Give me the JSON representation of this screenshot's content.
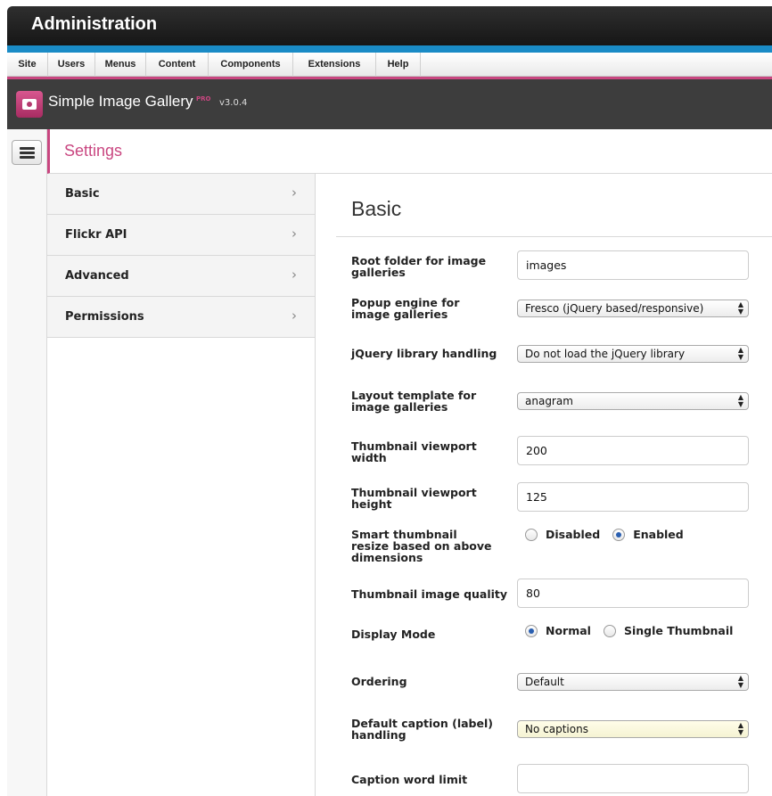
{
  "header": {
    "title": "Administration"
  },
  "menu": [
    "Site",
    "Users",
    "Menus",
    "Content",
    "Components",
    "Extensions",
    "Help"
  ],
  "component": {
    "name": "Simple Image Gallery",
    "badge": "PRO",
    "version": "v3.0.4"
  },
  "settings": {
    "title": "Settings"
  },
  "tabs": [
    {
      "label": "Basic"
    },
    {
      "label": "Flickr API"
    },
    {
      "label": "Advanced"
    },
    {
      "label": "Permissions"
    }
  ],
  "panel": {
    "title": "Basic"
  },
  "form": {
    "root_folder": {
      "label": "Root folder for image galleries",
      "value": "images"
    },
    "popup_engine": {
      "label": "Popup engine for image galleries",
      "value": "Fresco (jQuery based/responsive)"
    },
    "jquery": {
      "label": "jQuery library handling",
      "value": "Do not load the jQuery library"
    },
    "layout": {
      "label": "Layout template for image galleries",
      "value": "anagram"
    },
    "thumb_width": {
      "label": "Thumbnail viewport width",
      "value": "200"
    },
    "thumb_height": {
      "label": "Thumbnail viewport height",
      "value": "125"
    },
    "smart_resize": {
      "label": "Smart thumbnail resize based on above dimensions",
      "options": [
        "Disabled",
        "Enabled"
      ],
      "selected": "Enabled"
    },
    "quality": {
      "label": "Thumbnail image quality",
      "value": "80"
    },
    "display_mode": {
      "label": "Display Mode",
      "options": [
        "Normal",
        "Single Thumbnail"
      ],
      "selected": "Normal"
    },
    "ordering": {
      "label": "Ordering",
      "value": "Default"
    },
    "caption_handling": {
      "label": "Default caption (label) handling",
      "value": "No captions"
    },
    "caption_limit": {
      "label": "Caption word limit",
      "value": ""
    }
  },
  "icons": {
    "chevron": "chevron-right-icon",
    "menu": "hamburger-icon",
    "logo": "camera-icon"
  },
  "colors": {
    "accent": "#c94680",
    "blue_bar": "#1a8bc6",
    "toolbar": "#3d3d3d"
  }
}
